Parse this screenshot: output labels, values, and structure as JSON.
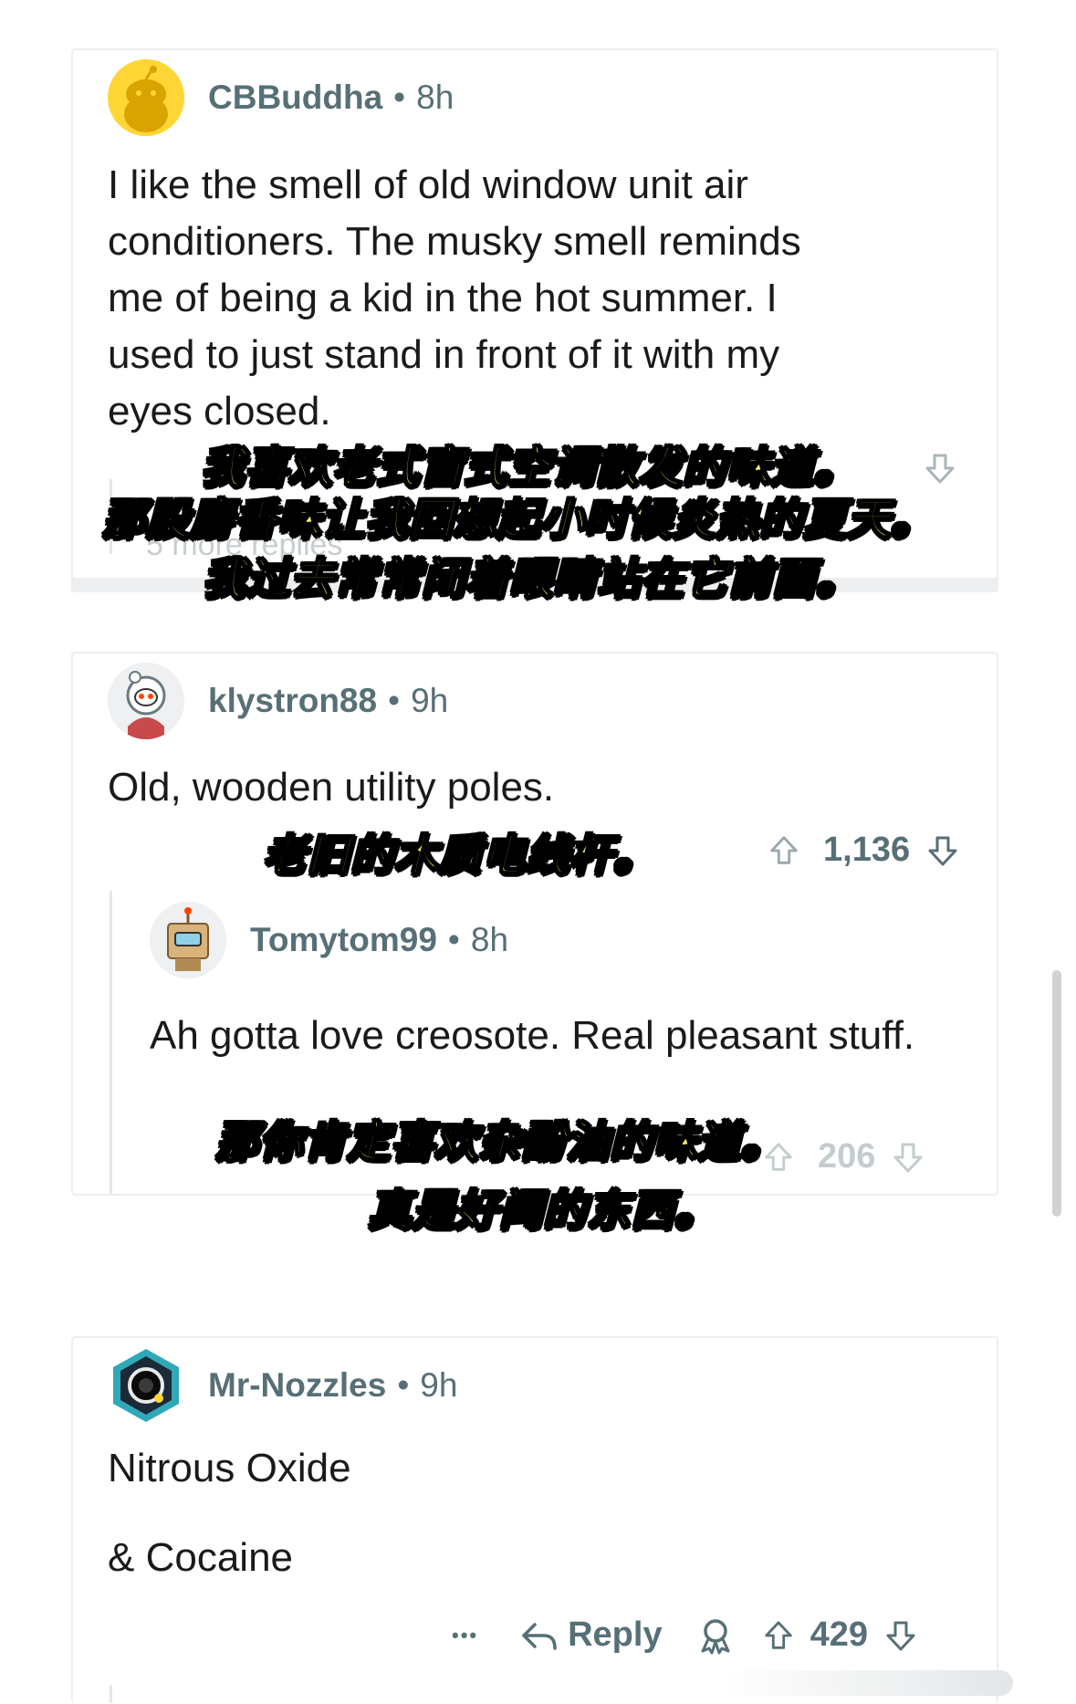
{
  "comments": [
    {
      "username": "CBBuddha",
      "separator": "•",
      "time": "8h",
      "body": "I like the smell of old window unit air conditioners. The musky smell reminds me of being a kid in the hot summer. I used to just stand in front of it with my eyes closed.",
      "more_replies": "5 more replies",
      "subtitle_lines": [
        "我喜欢老式窗式空调散发的味道。",
        "那股麝香味让我回想起小时候炎热的夏天。",
        "我过去常常闭着眼睛站在它前面。"
      ]
    },
    {
      "username": "klystron88",
      "separator": "•",
      "time": "9h",
      "body": "Old, wooden utility poles.",
      "score": "1,136",
      "subtitle_lines": [
        "老旧的木质电线杆。"
      ],
      "reply": {
        "username": "Tomytom99",
        "separator": "•",
        "time": "8h",
        "body": "Ah gotta love creosote. Real pleasant stuff.",
        "score": "206",
        "subtitle_lines": [
          "那你肯定喜欢杂酚油的味道。",
          "真是好闻的东西。"
        ]
      }
    },
    {
      "username": "Mr-Nozzles",
      "separator": "•",
      "time": "9h",
      "body_lines": [
        "Nitrous Oxide",
        "& Cocaine"
      ],
      "actions": {
        "more": "•••",
        "reply_label": "Reply",
        "score": "429"
      }
    }
  ],
  "icons": {
    "avatar_1": "snoo-yellow-avatar",
    "avatar_2": "snoo-astronaut-avatar",
    "avatar_3": "snoo-robot-avatar",
    "avatar_4": "snoo-blackhole-avatar",
    "reply": "reply-arrow-icon",
    "award": "award-icon",
    "upvote": "upvote-arrow-icon",
    "downvote": "downvote-arrow-icon"
  },
  "colors": {
    "meta_gray": "#576f76",
    "subtitle_yellow": "#fbf06c",
    "card_border": "#eceef0"
  }
}
